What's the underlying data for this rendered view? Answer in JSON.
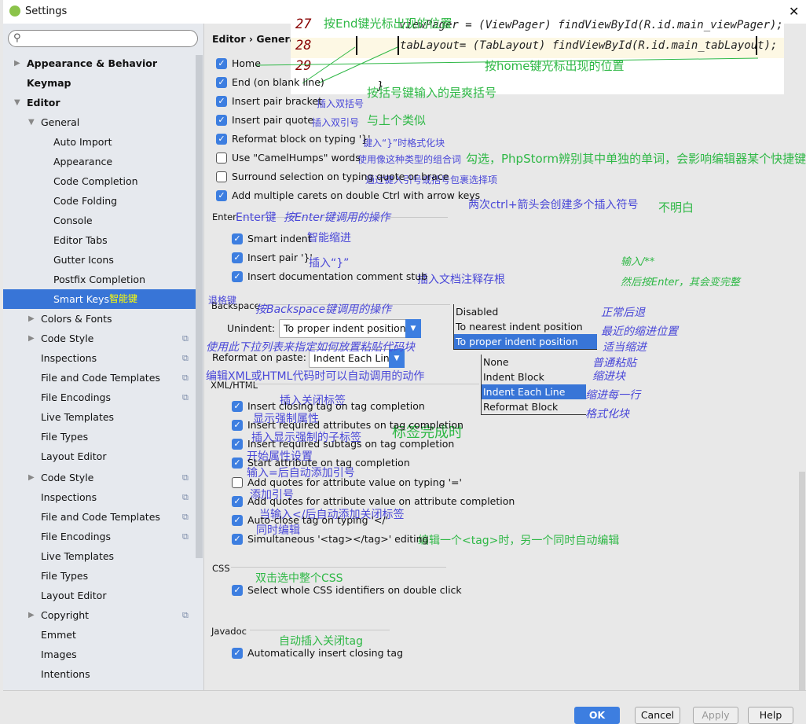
{
  "window": {
    "title": "Settings",
    "close": "✕"
  },
  "sidebar": {
    "search_placeholder": "",
    "items": [
      {
        "label": "Appearance & Behavior",
        "bold": true,
        "arrow": "▶",
        "level": 0
      },
      {
        "label": "Keymap",
        "bold": true,
        "level": 0
      },
      {
        "label": "Editor",
        "bold": true,
        "arrow": "▼",
        "level": 0
      },
      {
        "label": "General",
        "arrow": "▼",
        "level": 1
      },
      {
        "label": "Auto Import",
        "level": 2
      },
      {
        "label": "Appearance",
        "level": 2
      },
      {
        "label": "Code Completion",
        "level": 2
      },
      {
        "label": "Code Folding",
        "level": 2
      },
      {
        "label": "Console",
        "level": 2
      },
      {
        "label": "Editor Tabs",
        "level": 2
      },
      {
        "label": "Gutter Icons",
        "level": 2
      },
      {
        "label": "Postfix Completion",
        "level": 2
      },
      {
        "label": "Smart Keys",
        "level": 2,
        "selected": true
      },
      {
        "label": "Colors & Fonts",
        "arrow": "▶",
        "level": 1
      },
      {
        "label": "Code Style",
        "arrow": "▶",
        "level": 1,
        "copy": true
      },
      {
        "label": "Inspections",
        "level": 1,
        "copy": true
      },
      {
        "label": "File and Code Templates",
        "level": 1,
        "copy": true
      },
      {
        "label": "File Encodings",
        "level": 1,
        "copy": true
      },
      {
        "label": "Live Templates",
        "level": 1
      },
      {
        "label": "File Types",
        "level": 1
      },
      {
        "label": "Layout Editor",
        "level": 1
      },
      {
        "label": "Code Style",
        "arrow": "▶",
        "level": 1,
        "copy": true
      },
      {
        "label": "Inspections",
        "level": 1,
        "copy": true
      },
      {
        "label": "File and Code Templates",
        "level": 1,
        "copy": true
      },
      {
        "label": "File Encodings",
        "level": 1,
        "copy": true
      },
      {
        "label": "Live Templates",
        "level": 1
      },
      {
        "label": "File Types",
        "level": 1
      },
      {
        "label": "Layout Editor",
        "level": 1
      },
      {
        "label": "Copyright",
        "arrow": "▶",
        "level": 1,
        "copy": true
      },
      {
        "label": "Emmet",
        "level": 1
      },
      {
        "label": "Images",
        "level": 1
      },
      {
        "label": "Intentions",
        "level": 1
      }
    ],
    "selected_note": "智能键"
  },
  "breadcrumb": "Editor › General",
  "checkboxes": [
    {
      "label": "Home",
      "checked": true
    },
    {
      "label": "End (on blank line)",
      "checked": true
    },
    {
      "label": "Insert pair bracket",
      "checked": true
    },
    {
      "label": "Insert pair quote",
      "checked": true
    },
    {
      "label": "Reformat block on typing '}'",
      "checked": true
    },
    {
      "label": "Use \"CamelHumps\" words",
      "checked": false
    },
    {
      "label": "Surround selection on typing quote or brace",
      "checked": false
    },
    {
      "label": "Add multiple carets on double Ctrl with arrow keys",
      "checked": true
    },
    {
      "label": "Smart indent",
      "checked": true
    },
    {
      "label": "Insert pair '}'",
      "checked": true
    },
    {
      "label": "Insert documentation comment stub",
      "checked": true
    },
    {
      "label": "Insert closing tag on tag completion",
      "checked": true
    },
    {
      "label": "Insert required attributes on tag completion",
      "checked": true
    },
    {
      "label": "Insert required subtags on tag completion",
      "checked": true
    },
    {
      "label": "Start attribute on tag completion",
      "checked": true
    },
    {
      "label": "Add quotes for attribute value on typing '='",
      "checked": false
    },
    {
      "label": "Add quotes for attribute value on attribute completion",
      "checked": true
    },
    {
      "label": "Auto-close tag on typing '</'",
      "checked": true
    },
    {
      "label": "Simultaneous '<tag></tag>' editing",
      "checked": true
    },
    {
      "label": "Select whole CSS identifiers on double click",
      "checked": true
    },
    {
      "label": "Automatically insert closing tag",
      "checked": true
    }
  ],
  "sections": {
    "enter": "Enter",
    "backspace": "Backspace",
    "xml": "XML/HTML",
    "css": "CSS",
    "javadoc": "Javadoc"
  },
  "unindent": {
    "label": "Unindent:",
    "value": "To proper indent position",
    "options": [
      "Disabled",
      "To nearest indent position",
      "To proper indent position"
    ]
  },
  "paste": {
    "label": "Reformat on paste:",
    "value": "Indent Each Line",
    "options": [
      "None",
      "Indent Block",
      "Indent Each Line",
      "Reformat Block"
    ]
  },
  "code": {
    "line_numbers": [
      "27",
      "28",
      "29"
    ],
    "line27": "viewPager = (ViewPager) findViewById(R.id.main_viewPager);",
    "line28": "tabLayout= (TabLayout) findViewById(R.id.main_tabLayout);",
    "brace": "}"
  },
  "annotations": [
    "按End键光标出现的位置",
    "按home键光标出现的位置",
    "按括号键输入的是爽括号",
    "插入双括号",
    "插入双引号",
    "与上个类似",
    "键入“}”时格式化块",
    "使用像这种类型的组合词",
    "勾选，PhpStorm辨别其中单独的单词，会影响编辑器某个快捷键",
    "通过键入引号或括号包裹选择项",
    "两次ctrl+箭头会创建多个插入符号",
    "不明白",
    "Enter键",
    "按Enter键调用的操作",
    "智能缩进",
    "插入“}”",
    "插入文档注释存根",
    "输入/**",
    "然后按Enter，其会变完整",
    "退格键",
    "按Backspace键调用的操作",
    "正常后退",
    "最近的缩进位置",
    "适当缩进",
    "使用此下拉列表来指定如何放置粘贴代码块",
    "普通粘贴",
    "缩进块",
    "缩进每一行",
    "格式化块",
    "编辑XML或HTML代码时可以自动调用的动作",
    "插入关闭标签",
    "显示强制属性",
    "标签完成时",
    "插入显示强制的子标签",
    "开始属性设置",
    "输入=后自动添加引号",
    "添加引号",
    "当输入</后自动添加关闭标签",
    "同时编辑",
    "编辑一个<tag>时，另一个同时自动编辑",
    "双击选中整个CSS",
    "自动插入关闭tag"
  ],
  "buttons": {
    "ok": "OK",
    "cancel": "Cancel",
    "apply": "Apply",
    "help": "Help"
  },
  "colors": {
    "accent": "#3875d7",
    "annotation_green": "#2fb846",
    "annotation_blue": "#4a48d8"
  }
}
